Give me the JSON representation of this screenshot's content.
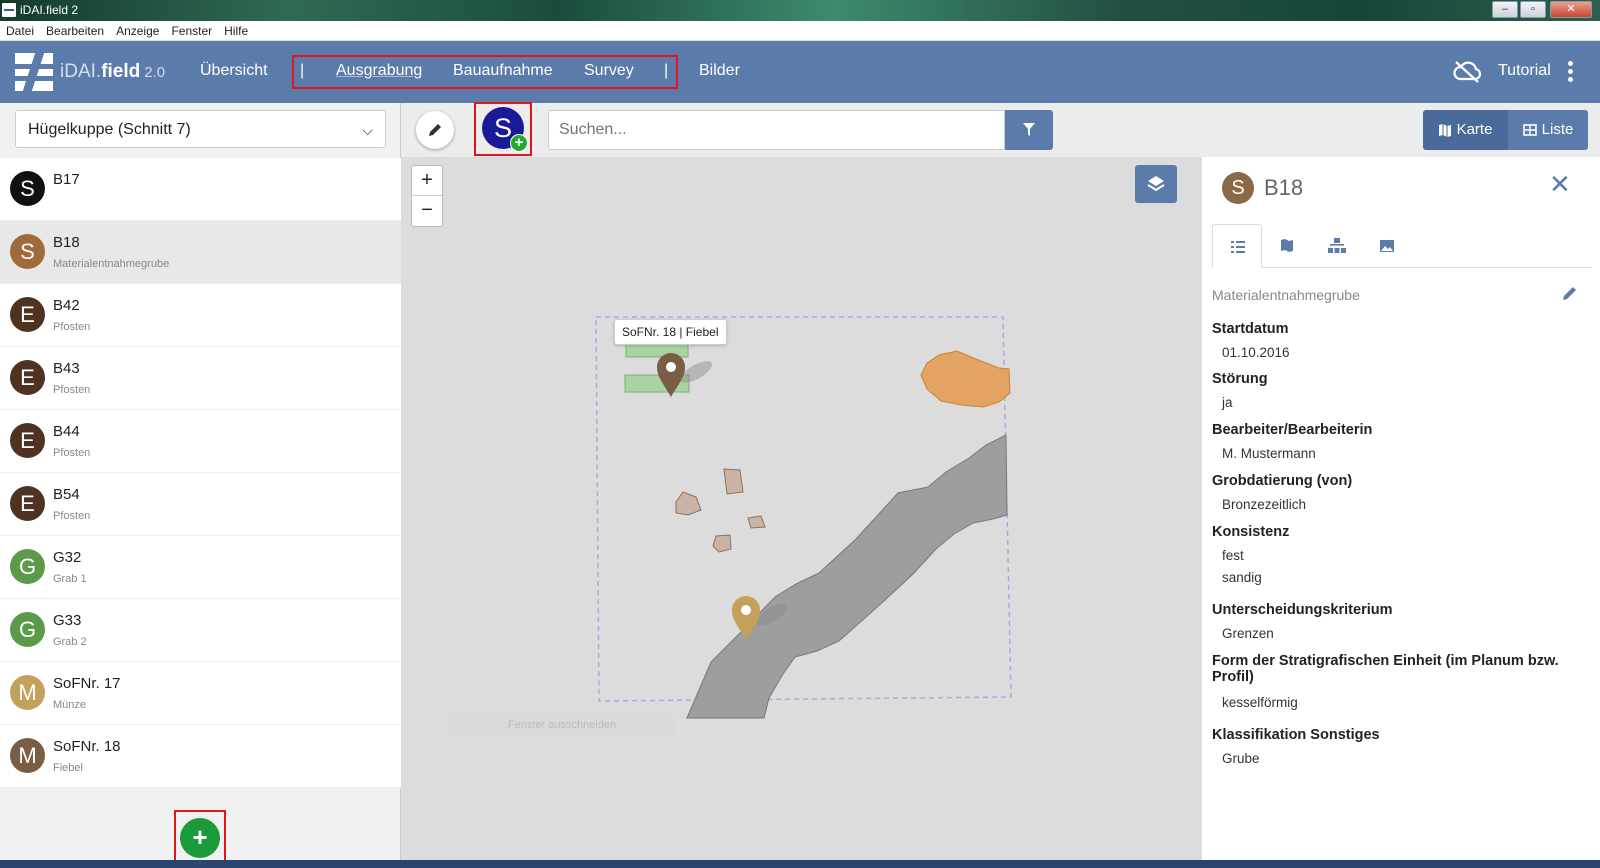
{
  "window": {
    "title": "iDAI.field 2"
  },
  "menu": [
    "Datei",
    "Bearbeiten",
    "Anzeige",
    "Fenster",
    "Hilfe"
  ],
  "navbar": {
    "brand_light": "iDAI.",
    "brand_bold": "field",
    "version": "2.0",
    "overview": "Übersicht",
    "separator": "|",
    "tabs": [
      "Ausgrabung",
      "Bauaufnahme",
      "Survey"
    ],
    "images": "Bilder",
    "tutorial": "Tutorial"
  },
  "left": {
    "project": "Hügelkuppe (Schnitt 7)",
    "items": [
      {
        "letter": "S",
        "title": "B17",
        "subtitle": "",
        "color": "#111111"
      },
      {
        "letter": "S",
        "title": "B18",
        "subtitle": "Materialentnahmegrube",
        "color": "#a06a3a"
      },
      {
        "letter": "E",
        "title": "B42",
        "subtitle": "Pfosten",
        "color": "#4e3320"
      },
      {
        "letter": "E",
        "title": "B43",
        "subtitle": "Pfosten",
        "color": "#4e3320"
      },
      {
        "letter": "E",
        "title": "B44",
        "subtitle": "Pfosten",
        "color": "#4e3320"
      },
      {
        "letter": "E",
        "title": "B54",
        "subtitle": "Pfosten",
        "color": "#4e3320"
      },
      {
        "letter": "G",
        "title": "G32",
        "subtitle": "Grab 1",
        "color": "#5a9a48"
      },
      {
        "letter": "G",
        "title": "G33",
        "subtitle": "Grab 2",
        "color": "#5a9a48"
      },
      {
        "letter": "M",
        "title": "SoFNr. 17",
        "subtitle": "Münze",
        "color": "#c4a15a"
      },
      {
        "letter": "M",
        "title": "SoFNr. 18",
        "subtitle": "Fiebel",
        "color": "#7a5d45"
      }
    ],
    "add_label": "+"
  },
  "toolbar": {
    "type_letter": "S",
    "search_placeholder": "Suchen...",
    "map_label": "Karte",
    "list_label": "Liste"
  },
  "map": {
    "tooltip": "SoFNr. 18 | Fiebel",
    "cutout": "Fenster ausschneiden"
  },
  "detail": {
    "letter": "S",
    "title": "B18",
    "category": "Materialentnahmegrube",
    "fields": [
      {
        "label": "Startdatum",
        "values": [
          "01.10.2016"
        ]
      },
      {
        "label": "Störung",
        "values": [
          "ja"
        ]
      },
      {
        "label": "Bearbeiter/Bearbeiterin",
        "values": [
          "M. Mustermann"
        ]
      },
      {
        "label": "Grobdatierung (von)",
        "values": [
          "Bronzezeitlich"
        ]
      },
      {
        "label": "Konsistenz",
        "values": [
          "fest",
          "sandig"
        ]
      },
      {
        "label": "Unterscheidungskriterium",
        "values": [
          "Grenzen"
        ]
      },
      {
        "label": "Form der Stratigrafischen Einheit (im Planum bzw. Profil)",
        "values": [
          "kesselförmig"
        ]
      },
      {
        "label": "Klassifikation Sonstiges",
        "values": [
          "Grube"
        ]
      }
    ]
  },
  "colors": {
    "accent": "#5b7baa",
    "highlight": "#e3141b",
    "add": "#1a9a3a"
  }
}
